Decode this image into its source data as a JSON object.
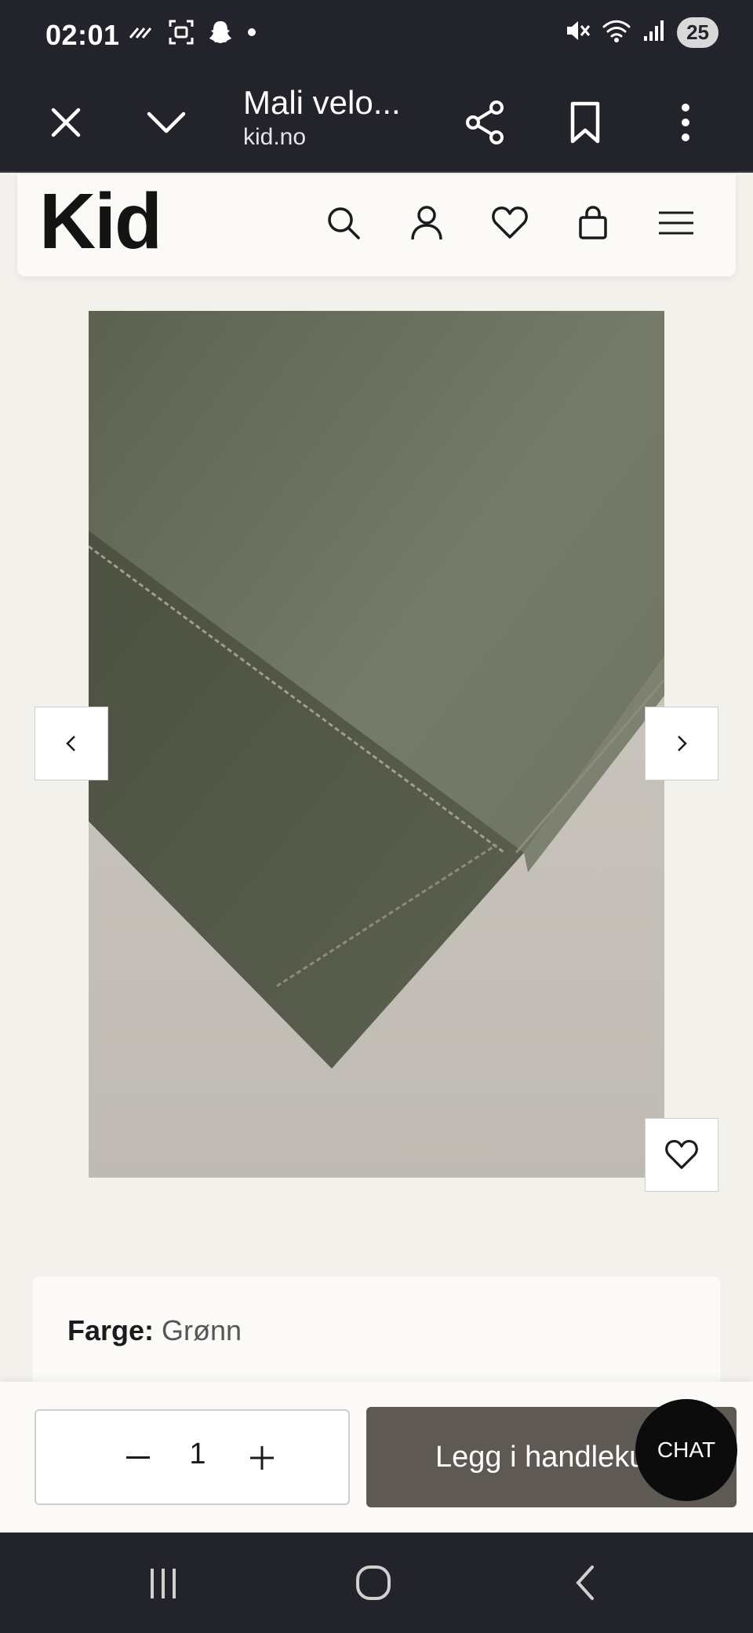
{
  "status_bar": {
    "time": "02:01",
    "battery": "25",
    "left_icons": [
      "sync-icon",
      "screenshot-icon",
      "snapchat-icon",
      "dot-icon"
    ],
    "right_icons": [
      "mute-icon",
      "wifi-icon",
      "signal-icon"
    ]
  },
  "browser": {
    "title": "Mali velo...",
    "url": "kid.no",
    "icons": [
      "close-icon",
      "chevron-down-icon",
      "share-icon",
      "bookmark-icon",
      "more-icon"
    ]
  },
  "header": {
    "logo": "Kid",
    "icons": [
      "search-icon",
      "account-icon",
      "heart-icon",
      "bag-icon",
      "menu-icon"
    ]
  },
  "product": {
    "image_desc_icon": "fabric-image",
    "color_label": "Farge:",
    "color_value": "Grønn"
  },
  "purchase": {
    "quantity": "1",
    "add_to_cart_label": "Legg i handlekurv",
    "chat_label": "CHAT"
  },
  "colors": {
    "dark_bar": "#23242b",
    "cart_button": "#5f5954",
    "page_bg": "#f3f1ec"
  }
}
